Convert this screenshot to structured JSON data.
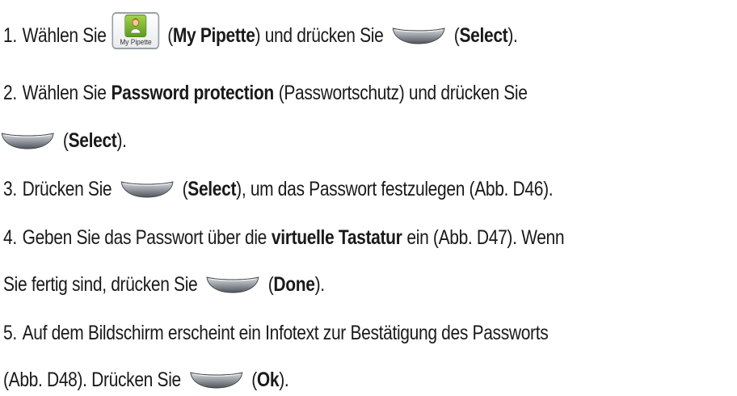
{
  "steps": [
    {
      "number": "1.",
      "t1": "Wählen Sie",
      "icon_label": "My Pipette",
      "p1": "(",
      "b1": "My Pipette",
      "p2": ") und drücken Sie",
      "p3": "(",
      "b2": "Select",
      "p4": ")."
    },
    {
      "number": "2.",
      "t1": "Wählen Sie",
      "b1": "Password protection",
      "p1": "(Passwortschutz) und drücken Sie",
      "p2": "(",
      "b2": "Select",
      "p3": ")."
    },
    {
      "number": "3.",
      "t1": "Drücken Sie",
      "p1": "(",
      "b1": "Select",
      "p2": "), um das Passwort festzulegen (Abb. D46)."
    },
    {
      "number": "4.",
      "t1": "Geben Sie das Passwort über die",
      "b1": "virtuelle Tastatur",
      "p1": "ein (Abb. D47). Wenn",
      "t2": "Sie fertig sind, drücken Sie",
      "p2": "(",
      "b2": "Done",
      "p3": ")."
    },
    {
      "number": "5.",
      "t1": "Auf dem Bildschirm erscheint ein Infotext zur Bestätigung des Passworts",
      "t2": "(Abb. D48). Drücken Sie",
      "p1": "(",
      "b1": "Ok",
      "p2": ")."
    }
  ],
  "icons": {
    "softkey": "softkey-button-icon",
    "app": "my-pipette-app-icon"
  },
  "colors": {
    "softkey_light": "#c9ccd1",
    "softkey_dark": "#5a5f66",
    "app_green": "#7cba2c"
  }
}
